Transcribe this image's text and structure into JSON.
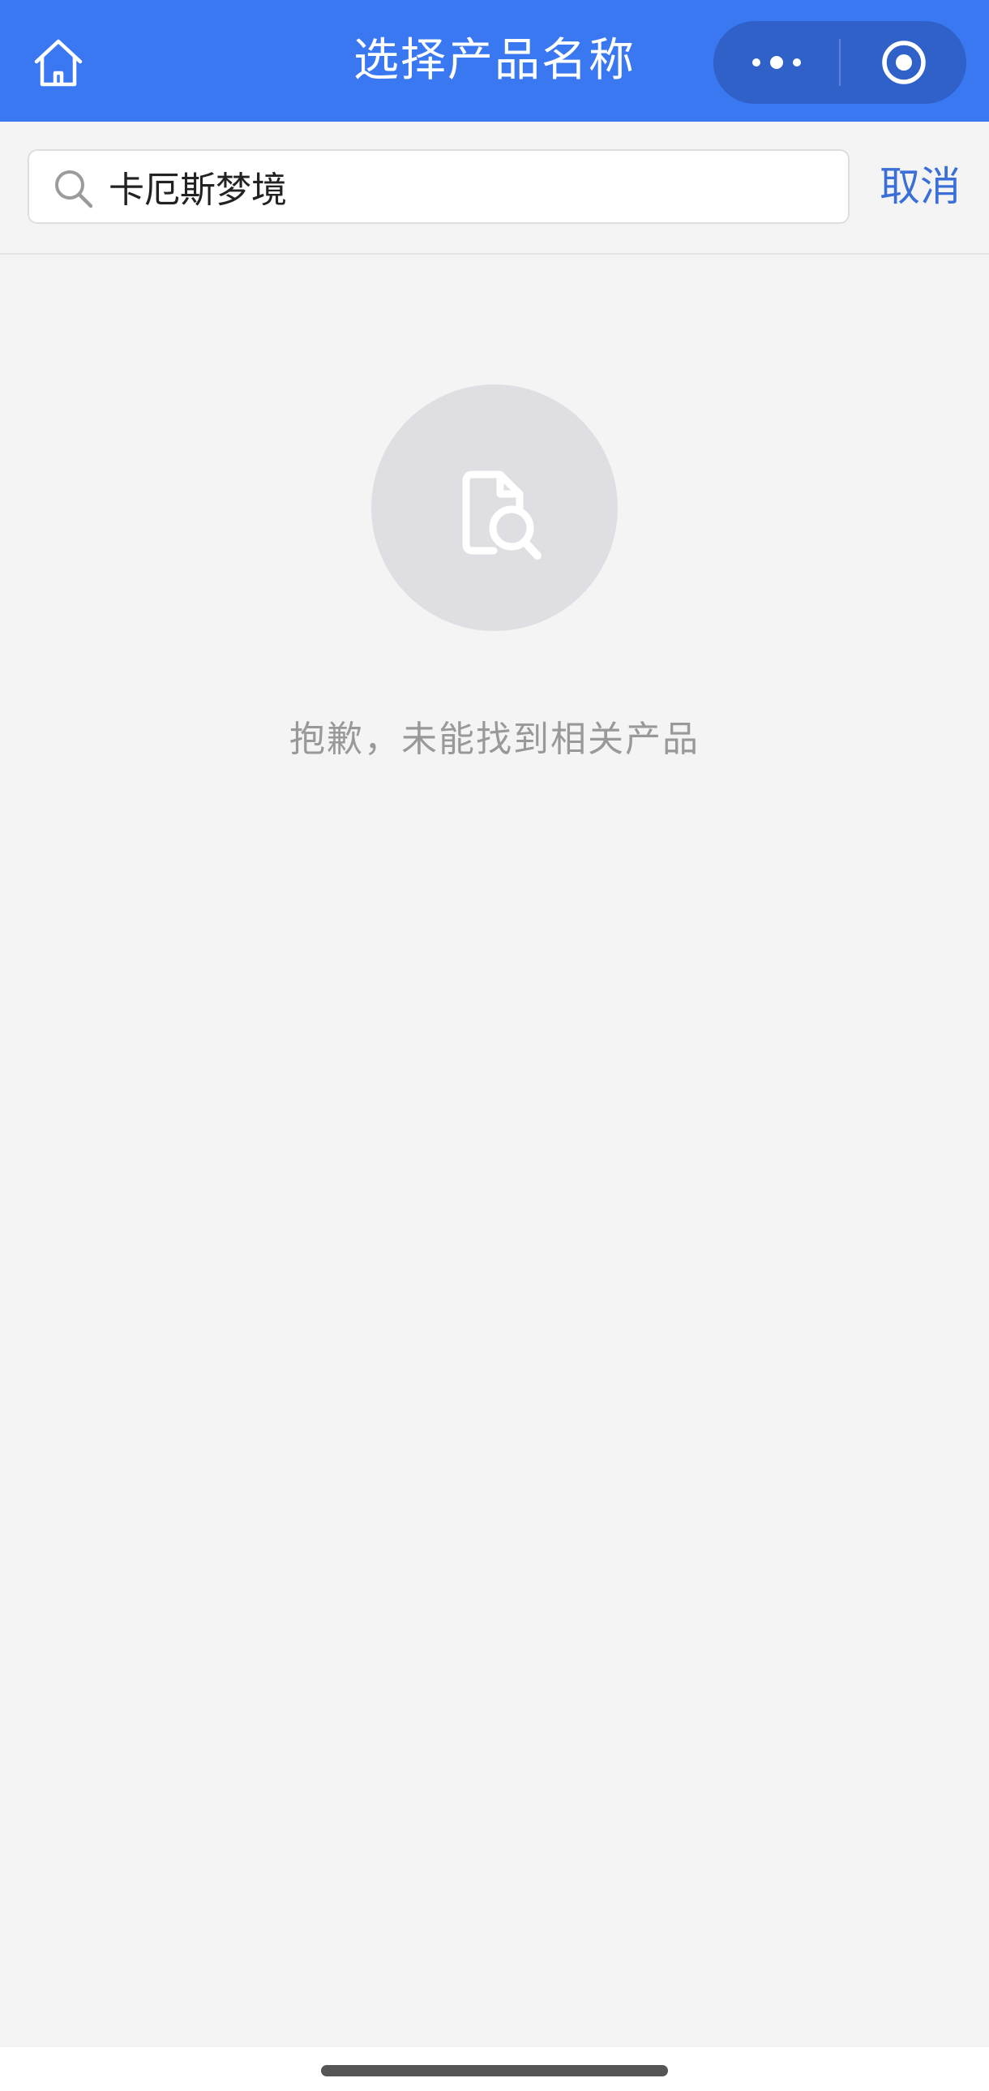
{
  "header": {
    "title": "选择产品名称",
    "home_icon": "home-icon",
    "more_icon": "more-dots-icon",
    "close_icon": "target-circle-icon",
    "background_color": "#3a78f2"
  },
  "search": {
    "value": "卡厄斯梦境",
    "icon": "search-icon",
    "cancel_label": "取消"
  },
  "empty_state": {
    "icon": "document-search-icon",
    "message": "抱歉，未能找到相关产品"
  },
  "colors": {
    "accent": "#3a6fd8",
    "page_background": "#f4f4f4",
    "empty_text": "#999999"
  }
}
